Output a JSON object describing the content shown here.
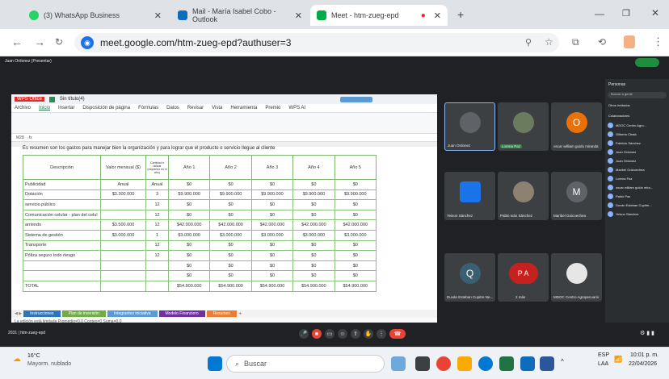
{
  "browser": {
    "tabs": [
      {
        "title": "(3) WhatsApp Business"
      },
      {
        "title": "Mail - María Isabel Cobo - Outlook"
      },
      {
        "title": "Meet - htm-zueg-epd"
      }
    ],
    "url": "meet.google.com/htm-zueg-epd?authuser=3",
    "colors": {
      "tabbar": "#dfe3e8",
      "accent": "#1a73e8"
    }
  },
  "meet": {
    "presenter_label": "Juan Ordonez (Presentar)",
    "meeting_code": "htm-zueg-epd",
    "meeting_name_short": "2031 | htm-zueg-epd",
    "tiles": [
      {
        "name": "Juan Ordonez"
      },
      {
        "name": "Lorena Paz"
      },
      {
        "name": "oscar william guido miranda",
        "initial": "O"
      },
      {
        "name": "Yeison Sánchez"
      },
      {
        "name": "Pablo Iván Sánchez"
      },
      {
        "name": "Maribel Goicoechea",
        "initial": "M"
      },
      {
        "name": "Duván Esteban Cupitre Ne...",
        "initial": "Q"
      },
      {
        "name": "2 más",
        "initial": "P A"
      },
      {
        "name": "MDOC Centro Agropecuario"
      }
    ],
    "people_panel": {
      "title": "Personas",
      "search": "Buscar a gente",
      "section1": "Otros invitados",
      "section2": "Colaboradores",
      "rows": [
        "MDOC Centro Agro...",
        "Gilberto Chalá",
        "Fabricio Sánchez",
        "Juan Ordonez",
        "Juan Ordonez",
        "Maribel Goicoechea",
        "Lorena Paz",
        "oscar william guido mira...",
        "Pablo Paz",
        "Duván Esteban Cupitre...",
        "Yeison Sánchez"
      ]
    }
  },
  "spreadsheet": {
    "app": "WPS Office",
    "file": "Sin título(4)",
    "menu": [
      "Archivo",
      "Inicio",
      "Insertar",
      "Disposición de página",
      "Fórmulas",
      "Datos",
      "Revisar",
      "Vista",
      "Herramienta",
      "Premio",
      "WPS AI"
    ],
    "cell_ref": "M28",
    "title": "Es resumen son los gastos para manejar bien la organización y para lograr que el producto o servicio llegue al cliente",
    "headers": [
      "Descripción",
      "Valor mensual ($)",
      "Cantidad a utilizar (requerido en el año)",
      "Año 1",
      "Año 2",
      "Año 3",
      "Año 4",
      "Año 5"
    ],
    "rows": [
      [
        "Publicidad",
        "Anual",
        "Anual",
        "$0",
        "$0",
        "$0",
        "$0",
        "$0"
      ],
      [
        "Dotación",
        "$3.300.000",
        "3",
        "$9.900.000",
        "$9.900.000",
        "$9.900.000",
        "$9.900.000",
        "$9.900.000"
      ],
      [
        "servicio público",
        "",
        "12",
        "$0",
        "$0",
        "$0",
        "$0",
        "$0"
      ],
      [
        "Comunicación celular - plan del celul",
        "",
        "12",
        "$0",
        "$0",
        "$0",
        "$0",
        "$0"
      ],
      [
        "arriendo",
        "$3.500.000",
        "12",
        "$42.000.000",
        "$42.000.000",
        "$42.000.000",
        "$42.000.000",
        "$42.000.000"
      ],
      [
        "Sistema de gestión",
        "$3.000.000",
        "1",
        "$3.000.000",
        "$3.000.000",
        "$3.000.000",
        "$3.000.000",
        "$3.000.000"
      ],
      [
        "Transporte",
        "",
        "12",
        "$0",
        "$0",
        "$0",
        "$0",
        "$0"
      ],
      [
        "Póliza seguro todo riesgo",
        "",
        "12",
        "$0",
        "$0",
        "$0",
        "$0",
        "$0"
      ],
      [
        "",
        "",
        "",
        "$0",
        "$0",
        "$0",
        "$0",
        "$0"
      ],
      [
        "",
        "",
        "",
        "$0",
        "$0",
        "$0",
        "$0",
        "$0"
      ],
      [
        "TOTAL",
        "",
        "",
        "$54.900.000",
        "$54.900.000",
        "$54.900.000",
        "$54.900.000",
        "$54.900.000"
      ]
    ],
    "sheet_tabs": [
      {
        "label": "Instrucciones",
        "color": "#2e75b6"
      },
      {
        "label": "Plan de inversión",
        "color": "#70ad47"
      },
      {
        "label": "Integrantes iniciativa",
        "color": "#5b9bd5"
      },
      {
        "label": "Modelo Financiero",
        "color": "#7030a0"
      },
      {
        "label": "Resumen",
        "color": "#ed7d31"
      }
    ],
    "status": "La edición está limitada   Promedio=0.0   Conteo=0   Suma=0.0"
  },
  "taskbar": {
    "weather": "16°C",
    "weather_desc": "Mayorm. nublado",
    "search": "Buscar",
    "lang": "ESP",
    "lang2": "LAA",
    "time": "10:01 p. m.",
    "date": "22/04/2026"
  }
}
